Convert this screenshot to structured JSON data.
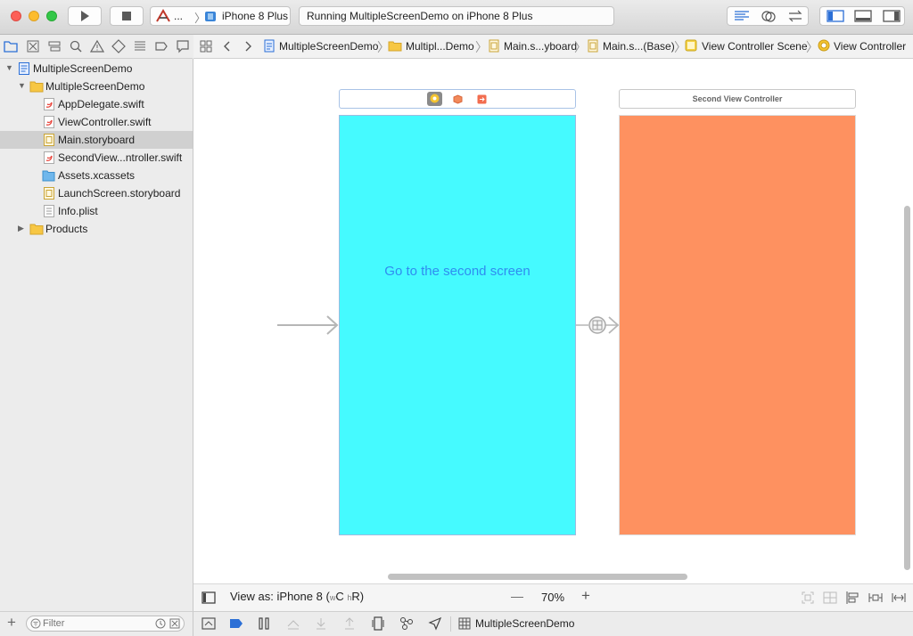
{
  "toolbar": {
    "scheme_label": "...",
    "device_label": "iPhone 8 Plus",
    "status_text": "Running MultipleScreenDemo on iPhone 8 Plus"
  },
  "jumpbar": {
    "crumbs": [
      "MultipleScreenDemo",
      "Multipl...Demo",
      "Main.s...yboard",
      "Main.s...(Base)",
      "View Controller Scene",
      "View Controller"
    ]
  },
  "navigator": {
    "items": [
      {
        "label": "MultipleScreenDemo",
        "icon": "project-icon"
      },
      {
        "label": "MultipleScreenDemo",
        "icon": "folder-icon"
      },
      {
        "label": "AppDelegate.swift",
        "icon": "swift-file-icon"
      },
      {
        "label": "ViewController.swift",
        "icon": "swift-file-icon"
      },
      {
        "label": "Main.storyboard",
        "icon": "storyboard-file-icon"
      },
      {
        "label": "SecondView...ntroller.swift",
        "icon": "swift-file-icon"
      },
      {
        "label": "Assets.xcassets",
        "icon": "assets-icon"
      },
      {
        "label": "LaunchScreen.storyboard",
        "icon": "storyboard-file-icon"
      },
      {
        "label": "Info.plist",
        "icon": "plist-file-icon"
      },
      {
        "label": "Products",
        "icon": "folder-icon"
      }
    ],
    "filter_placeholder": "Filter"
  },
  "canvas": {
    "first_scene_button": "Go to the second screen",
    "second_scene_title": "Second View Controller",
    "colors": {
      "first_view": "#45faff",
      "second_view": "#fe9160",
      "button_text": "#2f8cf0"
    }
  },
  "canvas_footer": {
    "view_as_label": "View as: iPhone 8",
    "size_class_open": "(",
    "size_class_w": "w",
    "size_class_c": "C",
    "size_class_h": "h",
    "size_class_r": "R",
    "size_class_close": ")",
    "zoom_minus": "—",
    "zoom_level": "70%",
    "zoom_plus": "+"
  },
  "debug_bar": {
    "target_label": "MultipleScreenDemo"
  }
}
